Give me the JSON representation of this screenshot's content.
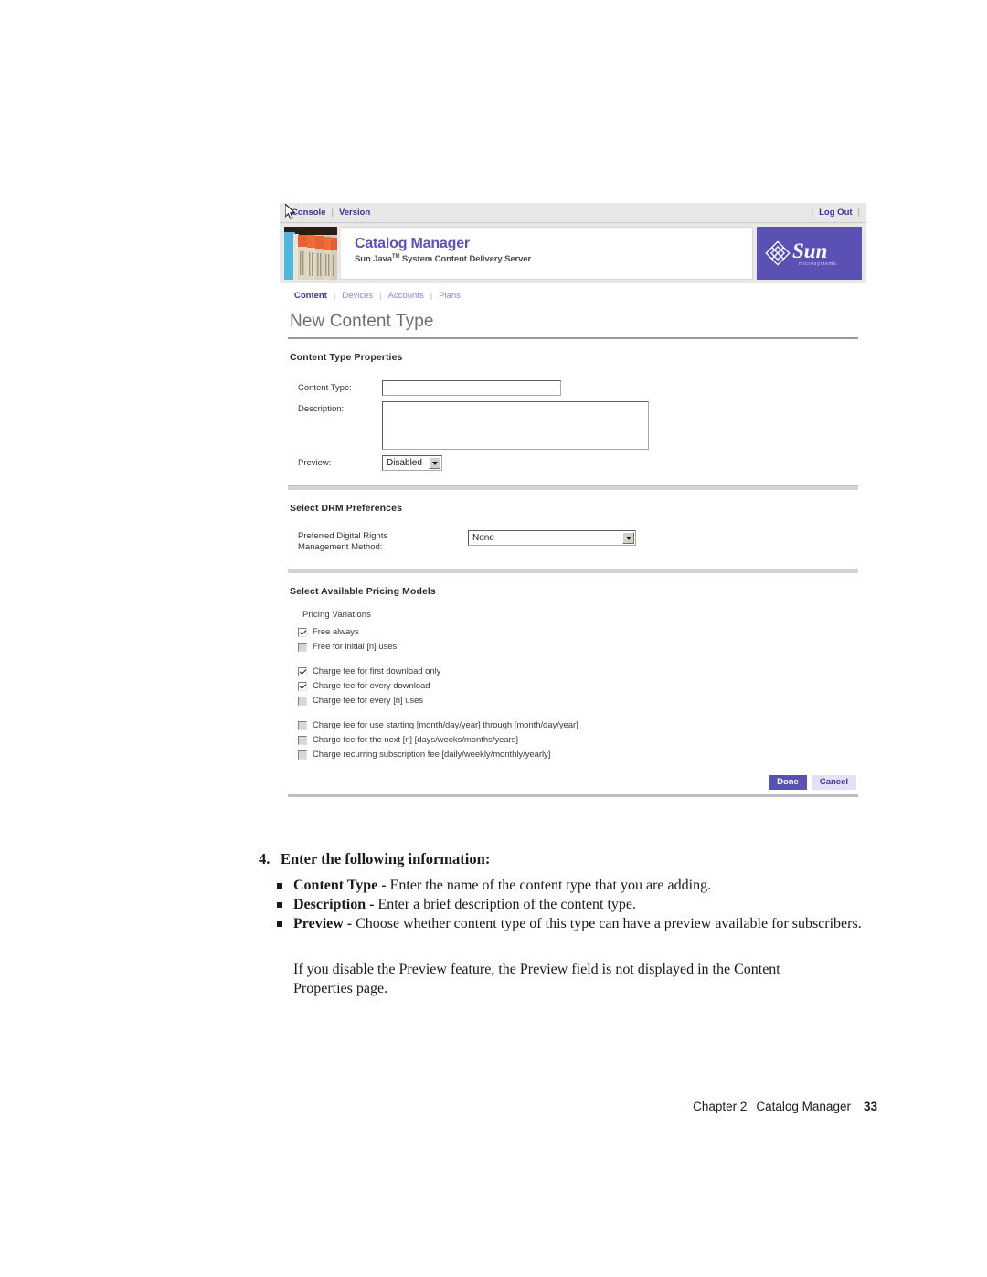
{
  "app": {
    "utility_bar": {
      "left_links": [
        "Console",
        "Version"
      ],
      "right_links": [
        "Log Out"
      ],
      "separator": "|"
    },
    "brand": {
      "title": "Catalog Manager",
      "subtitle_pre": "Sun Java",
      "subtitle_tm": "TM",
      "subtitle_post": " System Content Delivery Server",
      "logo_text": "Sun",
      "logo_tagline": "microsystems",
      "logo_bg": "#5a51b5",
      "title_color": "#5b52b5"
    },
    "tabs": [
      {
        "label": "Content",
        "active": true
      },
      {
        "label": "Devices",
        "active": false
      },
      {
        "label": "Accounts",
        "active": false
      },
      {
        "label": "Plans",
        "active": false
      }
    ],
    "page_heading": "New Content Type",
    "sections": {
      "properties": {
        "title": "Content Type Properties",
        "content_type_label": "Content Type:",
        "content_type_value": "",
        "description_label": "Description:",
        "description_value": "",
        "preview_label": "Preview:",
        "preview_value": "Disabled"
      },
      "drm": {
        "title": "Select DRM Preferences",
        "method_label_line1": "Preferred Digital Rights",
        "method_label_line2": "Management Method:",
        "method_value": "None"
      },
      "pricing": {
        "title": "Select Available Pricing Models",
        "caption": "Pricing Variations",
        "groups": [
          {
            "items": [
              {
                "label": "Free always",
                "checked": true
              },
              {
                "label": "Free for initial [n] uses",
                "checked": false
              }
            ]
          },
          {
            "items": [
              {
                "label": "Charge fee for first download only",
                "checked": true
              },
              {
                "label": "Charge fee for every download",
                "checked": true
              },
              {
                "label": "Charge fee for every [n] uses",
                "checked": false
              }
            ]
          },
          {
            "items": [
              {
                "label": "Charge fee for use starting [month/day/year] through [month/day/year]",
                "checked": false
              },
              {
                "label": "Charge fee for the next [n] [days/weeks/months/years]",
                "checked": false
              },
              {
                "label": "Charge recurring subscription fee [daily/weekly/monthly/yearly]",
                "checked": false
              }
            ]
          }
        ]
      }
    },
    "buttons": {
      "done": "Done",
      "cancel": "Cancel",
      "done_bg": "#5a51b5",
      "cancel_bg": "#e3e1f3"
    }
  },
  "document": {
    "step_number": "4.",
    "step_text": "Enter the following information:",
    "bullets": [
      {
        "term": "Content Type -",
        "text": " Enter the name of the content type that you are adding."
      },
      {
        "term": "Description -",
        "text": " Enter a brief description of the content type."
      },
      {
        "term": "Preview -",
        "text": " Choose whether content type of this type can have a preview available for subscribers."
      }
    ],
    "note": "If you disable the Preview feature, the Preview field is not displayed in the Content Properties page.",
    "footer_chapter": "Chapter 2",
    "footer_title": "Catalog Manager",
    "footer_page": "33"
  }
}
